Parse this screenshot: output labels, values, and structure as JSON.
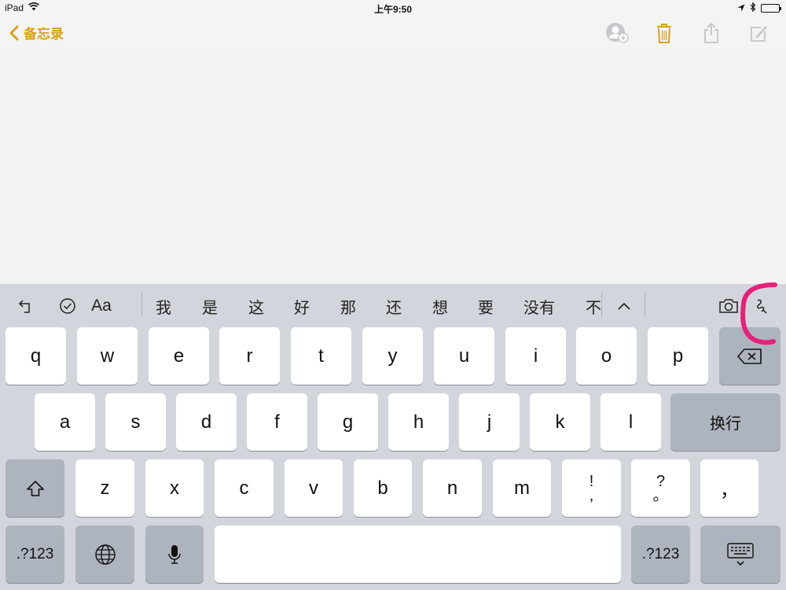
{
  "status_bar": {
    "device": "iPad",
    "time": "上午9:50"
  },
  "nav": {
    "back_label": "备忘录",
    "accent_color": "#d9a21b",
    "icons": [
      "add-person-icon",
      "trash-icon",
      "share-icon",
      "compose-icon"
    ]
  },
  "shortcut_bar": {
    "left_icons": [
      "undo-icon",
      "checklist-icon"
    ],
    "format_label": "Aa",
    "candidates": [
      "我",
      "是",
      "这",
      "好",
      "那",
      "还",
      "想",
      "要",
      "没有",
      "不"
    ],
    "right_icons": [
      "expand-candidates-icon",
      "camera-icon",
      "sketch-icon"
    ]
  },
  "keyboard": {
    "row1": [
      "q",
      "w",
      "e",
      "r",
      "t",
      "y",
      "u",
      "i",
      "o",
      "p"
    ],
    "row2": [
      "a",
      "s",
      "d",
      "f",
      "g",
      "h",
      "j",
      "k",
      "l"
    ],
    "return_label": "换行",
    "row3": [
      "z",
      "x",
      "c",
      "v",
      "b",
      "n",
      "m"
    ],
    "punct1_top": "!",
    "punct1_bottom": ",",
    "punct2_top": "?",
    "punct2_bottom": "。",
    "punct3": "，",
    "num_left": ".?123",
    "num_right": ".?123",
    "space_label": ""
  },
  "colors": {
    "keyboard_bg": "#d2d5db",
    "key_light": "#ffffff",
    "key_dark": "#aeb4be",
    "annotation": "#e8207a"
  }
}
